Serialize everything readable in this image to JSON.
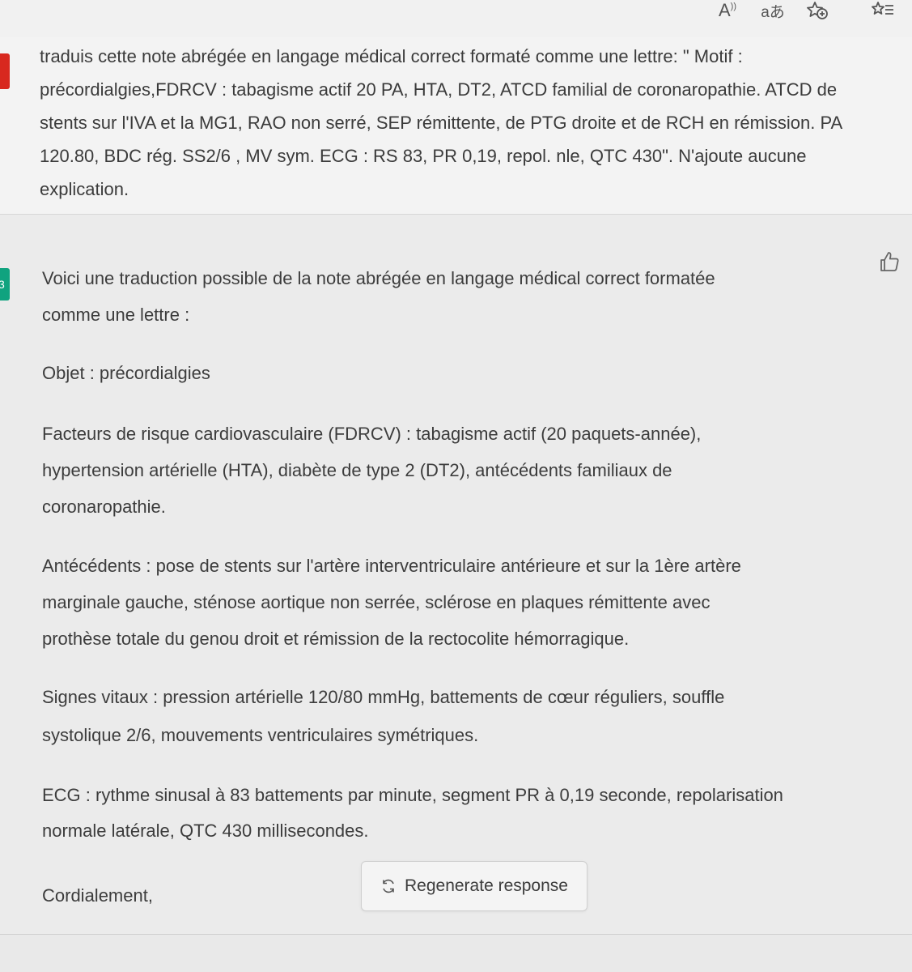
{
  "toolbar": {
    "read_aloud_icon": "read-aloud-icon",
    "translate_icon": "translate-icon",
    "add_favorite_icon": "add-favorite-icon",
    "favorites_icon": "favorites-icon",
    "read_aloud_glyph": "A",
    "translate_glyph": "aあ"
  },
  "user_message": {
    "avatar_color": "#d8281f",
    "text": "traduis cette note abrégée en langage médical correct formaté comme une lettre: \" Motif : précordialgies,FDRCV : tabagisme actif 20 PA, HTA, DT2, ATCD familial de coronaropathie. ATCD de stents sur l'IVA et la MG1, RAO non serré, SEP rémittente, de PTG droite et de RCH en rémission. PA 120.80, BDC rég. SS2/6 , MV sym. ECG : RS 83, PR 0,19, repol. nle, QTC 430\". N'ajoute aucune explication."
  },
  "assistant_message": {
    "avatar_color": "#10a37f",
    "avatar_glyph": "3",
    "thumb_icon": "thumbs-up-icon",
    "intro": [
      "Voici une traduction possible de la note abrégée en langage médical correct formatée",
      "comme une lettre :"
    ],
    "objet": "Objet : précordialgies",
    "facteurs": [
      "Facteurs de risque cardiovasculaire (FDRCV) : tabagisme actif (20 paquets-année),",
      "hypertension artérielle (HTA), diabète de type 2 (DT2), antécédents familiaux de",
      "coronaropathie."
    ],
    "antecedents": [
      "Antécédents : pose de stents sur l'artère interventriculaire antérieure et sur la 1ère artère",
      "marginale gauche, sténose aortique non serrée, sclérose en plaques rémittente avec",
      "prothèse totale du genou droit et rémission de la rectocolite hémorragique."
    ],
    "signes": [
      "Signes vitaux : pression artérielle 120/80 mmHg, battements de cœur réguliers, souffle",
      "systolique 2/6, mouvements ventriculaires symétriques."
    ],
    "ecg": [
      "ECG : rythme sinusal à 83 battements par minute, segment PR à 0,19 seconde, repolarisation",
      "normale latérale, QTC 430 millisecondes."
    ],
    "closing": "Cordialement,"
  },
  "regenerate": {
    "label": "Regenerate response",
    "icon": "refresh-icon"
  }
}
